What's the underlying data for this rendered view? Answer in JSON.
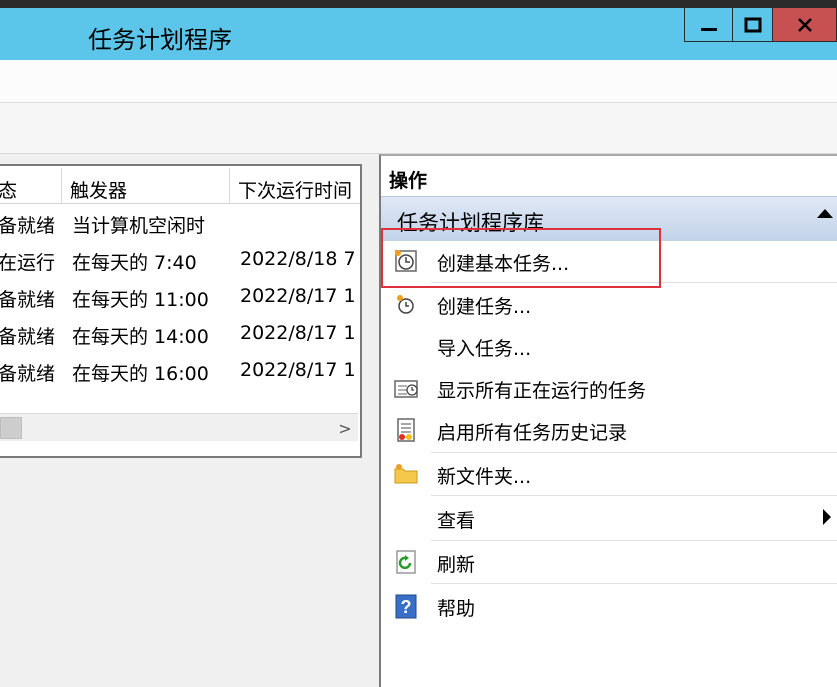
{
  "window": {
    "title": "任务计划程序"
  },
  "task_list": {
    "columns": [
      "态",
      "触发器",
      "下次运行时间"
    ],
    "rows": [
      {
        "status": "备就绪",
        "trigger": "当计算机空闲时",
        "next_run": ""
      },
      {
        "status": "在运行",
        "trigger": "在每天的 7:40",
        "next_run": "2022/8/18 7"
      },
      {
        "status": "备就绪",
        "trigger": "在每天的 11:00",
        "next_run": "2022/8/17 1"
      },
      {
        "status": "备就绪",
        "trigger": "在每天的 14:00",
        "next_run": "2022/8/17 1"
      },
      {
        "status": "备就绪",
        "trigger": "在每天的 16:00",
        "next_run": "2022/8/17 1"
      }
    ],
    "scroll_right_glyph": ">"
  },
  "actions": {
    "title": "操作",
    "section": "任务计划程序库",
    "items": [
      {
        "label": "创建基本任务...",
        "icon": "create-basic-task-icon"
      },
      {
        "label": "创建任务...",
        "icon": "create-task-icon"
      },
      {
        "label": "导入任务...",
        "icon": ""
      },
      {
        "label": "显示所有正在运行的任务",
        "icon": "running-tasks-icon"
      },
      {
        "label": "启用所有任务历史记录",
        "icon": "history-icon"
      },
      {
        "label": "新文件夹...",
        "icon": "folder-icon"
      },
      {
        "label": "查看",
        "icon": ""
      },
      {
        "label": "刷新",
        "icon": "refresh-icon"
      },
      {
        "label": "帮助",
        "icon": "help-icon"
      }
    ]
  },
  "colors": {
    "titlebar": "#5cc6ea",
    "close_button": "#c75050",
    "highlight_box": "#e0303a"
  }
}
